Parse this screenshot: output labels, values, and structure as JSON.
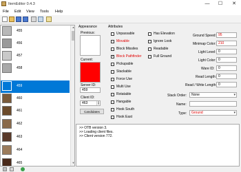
{
  "window": {
    "title": "ItemEditor 0.4.3",
    "minimize": "—",
    "maximize": "☐",
    "close": "✕"
  },
  "menu": [
    "File",
    "Edit",
    "View",
    "Tools",
    "Help"
  ],
  "items": [
    {
      "id": "455",
      "color": "#b8b8b8",
      "selected": false
    },
    {
      "id": "456",
      "color": "#9a9a9a",
      "selected": false
    },
    {
      "id": "457",
      "color": "#c9c9c9",
      "selected": false
    },
    {
      "id": "458",
      "color": "#a9a9a9",
      "selected": false
    },
    {
      "id": "459",
      "color": "#0078d7",
      "selected": true
    },
    {
      "id": "460",
      "color": "#7a5a3a",
      "selected": false
    },
    {
      "id": "461",
      "color": "#6b4a2a",
      "selected": false
    },
    {
      "id": "462",
      "color": "#8a6a4a",
      "selected": false
    },
    {
      "id": "463",
      "color": "#5a3a2a",
      "selected": false
    },
    {
      "id": "464",
      "color": "#9b7b5b",
      "selected": false
    },
    {
      "id": "465",
      "color": "#4a2a1a",
      "selected": false
    }
  ],
  "appearance": {
    "heading": "Appearance",
    "previous_label": "Previous:",
    "current_label": "Current:",
    "server_id_label": "Server ID:",
    "server_id": "459",
    "client_id_label": "Client ID:",
    "client_id": "463",
    "candidates_button": "Candidates",
    "current_color": "#ff0000"
  },
  "attributes": {
    "heading": "Attributes",
    "col1": [
      {
        "label": "Unpassable",
        "checked": false,
        "red": false
      },
      {
        "label": "Movable",
        "checked": false,
        "red": true
      },
      {
        "label": "Block Missiles",
        "checked": false,
        "red": false
      },
      {
        "label": "Block Pathfinder",
        "checked": true,
        "red": true
      },
      {
        "label": "Pickupable",
        "checked": false,
        "red": false
      },
      {
        "label": "Stackable",
        "checked": false,
        "red": false
      },
      {
        "label": "Force Use",
        "checked": false,
        "red": false
      },
      {
        "label": "Multi Use",
        "checked": false,
        "red": false
      },
      {
        "label": "Rotatable",
        "checked": false,
        "red": false
      },
      {
        "label": "Hangable",
        "checked": false,
        "red": false
      },
      {
        "label": "Hook South",
        "checked": false,
        "red": false
      },
      {
        "label": "Hook East",
        "checked": false,
        "red": false
      }
    ],
    "col2": [
      {
        "label": "Has Elevation",
        "checked": false,
        "red": false
      },
      {
        "label": "Ignore Look",
        "checked": false,
        "red": false
      },
      {
        "label": "Readable",
        "checked": false,
        "red": false
      },
      {
        "label": "Full Ground",
        "checked": false,
        "red": false
      }
    ]
  },
  "fields": {
    "ground_speed_label": "Ground Speed:",
    "ground_speed": "95",
    "minimap_label": "Minimap Color:",
    "minimap": "210",
    "light_level_label": "Light Level:",
    "light_level": "0",
    "light_color_label": "Light Color:",
    "light_color": "0",
    "ware_id_label": "Ware ID:",
    "ware_id": "0",
    "read_length_label": "Read Length:",
    "read_length": "0",
    "read_write_label": "Read / Write Length:",
    "read_write": "0",
    "stack_order_label": "Stack Order:",
    "stack_order": "None",
    "name_label": "Name:",
    "name": "",
    "type_label": "Type:",
    "type": "Ground"
  },
  "log": [
    ">> OTB version 3.",
    ">> Loading client files.",
    ">> Client version 772."
  ],
  "colors": {
    "selection": "#0078d7",
    "warning": "#e00000"
  }
}
